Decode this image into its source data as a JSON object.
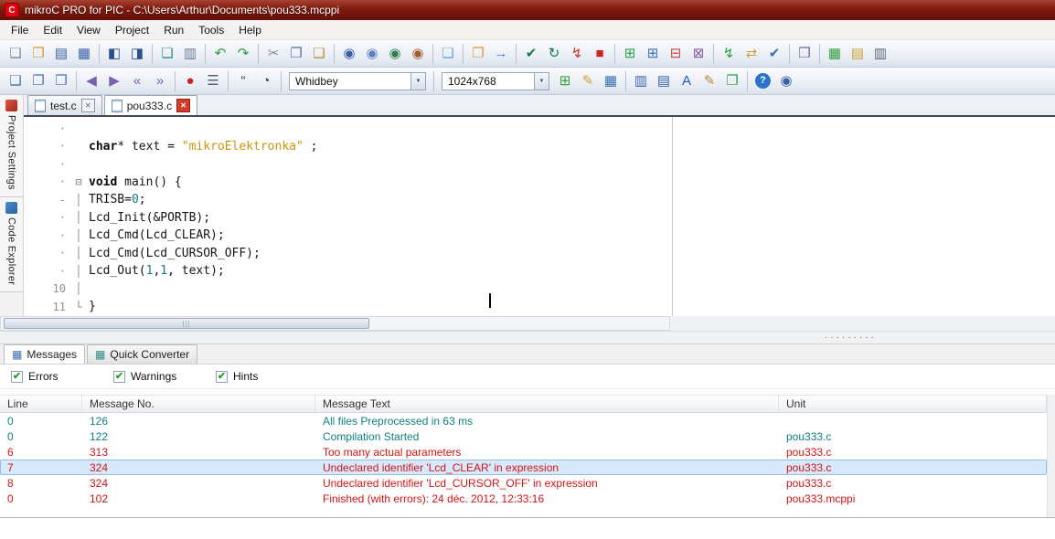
{
  "window": {
    "title": "mikroC PRO for PIC - C:\\Users\\Arthur\\Documents\\pou333.mcppi",
    "logo_letter": "C"
  },
  "menu": {
    "items": [
      "File",
      "Edit",
      "View",
      "Project",
      "Run",
      "Tools",
      "Help"
    ]
  },
  "toolbars": {
    "row1": [
      {
        "t": "i",
        "n": "new-file",
        "g": "❏",
        "c": "#7b8aa0"
      },
      {
        "t": "i",
        "n": "open-file",
        "g": "❒",
        "c": "#d79b2f"
      },
      {
        "t": "i",
        "n": "save-file",
        "g": "▤",
        "c": "#3a5fa8"
      },
      {
        "t": "i",
        "n": "save-all",
        "g": "▦",
        "c": "#3a5fa8"
      },
      {
        "t": "s"
      },
      {
        "t": "i",
        "n": "code-editor",
        "g": "◧",
        "c": "#2e4f8e"
      },
      {
        "t": "i",
        "n": "code-templates",
        "g": "◨",
        "c": "#2e4f8e"
      },
      {
        "t": "s"
      },
      {
        "t": "i",
        "n": "print-preview",
        "g": "❏",
        "c": "#2e8b8b"
      },
      {
        "t": "i",
        "n": "print",
        "g": "▥",
        "c": "#69788c"
      },
      {
        "t": "s"
      },
      {
        "t": "i",
        "n": "undo",
        "g": "↶",
        "c": "#2f9e3f"
      },
      {
        "t": "i",
        "n": "redo",
        "g": "↷",
        "c": "#2f9e3f"
      },
      {
        "t": "s"
      },
      {
        "t": "i",
        "n": "cut",
        "g": "✂",
        "c": "#8a8a8a"
      },
      {
        "t": "i",
        "n": "copy",
        "g": "❐",
        "c": "#4a6fb0"
      },
      {
        "t": "i",
        "n": "paste",
        "g": "❑",
        "c": "#bb8d35"
      },
      {
        "t": "s"
      },
      {
        "t": "i",
        "n": "find",
        "g": "◉",
        "c": "#3a5fa8"
      },
      {
        "t": "i",
        "n": "find-next",
        "g": "◉",
        "c": "#5a7fc0"
      },
      {
        "t": "i",
        "n": "find-in-files",
        "g": "◉",
        "c": "#2e7d4f"
      },
      {
        "t": "i",
        "n": "replace",
        "g": "◉",
        "c": "#a05a2c"
      },
      {
        "t": "s"
      },
      {
        "t": "i",
        "n": "goto-line",
        "g": "❏",
        "c": "#6aa0d8"
      },
      {
        "t": "s"
      },
      {
        "t": "i",
        "n": "copy-rtf",
        "g": "❐",
        "c": "#d79b2f"
      },
      {
        "t": "i",
        "n": "export-code",
        "g": "→",
        "c": "#3a7fd0"
      },
      {
        "t": "s"
      },
      {
        "t": "i",
        "n": "build-project",
        "g": "✔",
        "c": "#117a4a"
      },
      {
        "t": "i",
        "n": "rebuild-all",
        "g": "↻",
        "c": "#117a4a"
      },
      {
        "t": "i",
        "n": "build-and-program",
        "g": "↯",
        "c": "#cc3322"
      },
      {
        "t": "i",
        "n": "stop-build",
        "g": "■",
        "c": "#cc2222"
      },
      {
        "t": "s"
      },
      {
        "t": "i",
        "n": "new-project",
        "g": "⊞",
        "c": "#2f9e3f"
      },
      {
        "t": "i",
        "n": "add-file-to-project",
        "g": "⊞",
        "c": "#3a6fb0"
      },
      {
        "t": "i",
        "n": "remove-file-from-project",
        "g": "⊟",
        "c": "#cc4433"
      },
      {
        "t": "i",
        "n": "close-project",
        "g": "⊠",
        "c": "#8a5a9a"
      },
      {
        "t": "s"
      },
      {
        "t": "i",
        "n": "program-mcu",
        "g": "↯",
        "c": "#2f9e3f"
      },
      {
        "t": "i",
        "n": "read-mcu",
        "g": "⇄",
        "c": "#caa23a"
      },
      {
        "t": "i",
        "n": "verify-mcu",
        "g": "✔",
        "c": "#3a6fb0"
      },
      {
        "t": "s"
      },
      {
        "t": "i",
        "n": "package-manager",
        "g": "❒",
        "c": "#7a5fb0"
      },
      {
        "t": "s"
      },
      {
        "t": "i",
        "n": "library-manager",
        "g": "▦",
        "c": "#2f9e3f"
      },
      {
        "t": "i",
        "n": "options",
        "g": "▤",
        "c": "#caa23a"
      },
      {
        "t": "i",
        "n": "statistics",
        "g": "▥",
        "c": "#556677"
      }
    ],
    "row2": [
      {
        "t": "i",
        "n": "show-procedures-list",
        "g": "❑",
        "c": "#4a6fb0"
      },
      {
        "t": "i",
        "n": "show-code-explorer",
        "g": "❐",
        "c": "#4a6fb0"
      },
      {
        "t": "i",
        "n": "show-project-manager",
        "g": "❒",
        "c": "#4a6fb0"
      },
      {
        "t": "s"
      },
      {
        "t": "i",
        "n": "outdent",
        "g": "◀",
        "c": "#7a5fb0"
      },
      {
        "t": "i",
        "n": "indent",
        "g": "▶",
        "c": "#7a5fb0"
      },
      {
        "t": "i",
        "n": "comment-lines",
        "g": "«",
        "c": "#7a5fb0"
      },
      {
        "t": "i",
        "n": "uncomment-lines",
        "g": "»",
        "c": "#7a5fb0"
      },
      {
        "t": "s"
      },
      {
        "t": "i",
        "n": "record-macro",
        "g": "●",
        "c": "#cc2222"
      },
      {
        "t": "i",
        "n": "macros-list",
        "g": "☰",
        "c": "#556677"
      },
      {
        "t": "s"
      },
      {
        "t": "i",
        "n": "toggle-comment",
        "g": "“",
        "c": "#3a4a5a"
      },
      {
        "t": "i",
        "n": "stopwatch",
        "g": "◔",
        "c": "#3a4a5a"
      },
      {
        "t": "s"
      },
      {
        "t": "c",
        "n": "style-combo",
        "v": "Whidbey",
        "w": 150
      },
      {
        "t": "s"
      },
      {
        "t": "c",
        "n": "resolution-combo",
        "v": "1024x768",
        "w": 118
      },
      {
        "t": "i",
        "n": "add-display",
        "g": "⊞",
        "c": "#2f9e3f"
      },
      {
        "t": "i",
        "n": "edit-display",
        "g": "✎",
        "c": "#caa23a"
      },
      {
        "t": "i",
        "n": "display-grid",
        "g": "▦",
        "c": "#3a6fb0"
      },
      {
        "t": "s"
      },
      {
        "t": "i",
        "n": "show-breakpoints",
        "g": "▥",
        "c": "#3a5fa8"
      },
      {
        "t": "i",
        "n": "show-watch-window",
        "g": "▤",
        "c": "#3a5fa8"
      },
      {
        "t": "i",
        "n": "font-settings",
        "g": "A",
        "c": "#2255cc"
      },
      {
        "t": "i",
        "n": "edit-settings",
        "g": "✎",
        "c": "#b98a33"
      },
      {
        "t": "i",
        "n": "window-layout",
        "g": "❐",
        "c": "#2f9e3f"
      },
      {
        "t": "s"
      },
      {
        "t": "i",
        "n": "help",
        "g": "?",
        "c": "#ffffff",
        "bg": "#2a72cc",
        "round": true
      },
      {
        "t": "i",
        "n": "search-help",
        "g": "◉",
        "c": "#3a5fa8"
      }
    ]
  },
  "doc_tabs": [
    {
      "label": "test.c",
      "active": false
    },
    {
      "label": "pou333.c",
      "active": true
    }
  ],
  "sidebar": {
    "tabs": [
      {
        "label": "Project Settings",
        "icon": "project-settings-icon",
        "color1": "#e05545",
        "color2": "#a02818"
      },
      {
        "label": "Code Explorer",
        "icon": "code-explorer-icon",
        "color1": "#4a8fd0",
        "color2": "#2a5fa0"
      }
    ]
  },
  "editor": {
    "lines": [
      {
        "g": "·",
        "f": "",
        "tk": []
      },
      {
        "g": "·",
        "f": "",
        "tk": [
          {
            "c": "k",
            "t": "char"
          },
          {
            "c": "p",
            "t": "* text = "
          },
          {
            "c": "s",
            "t": "\"mikroElektronka\""
          },
          {
            "c": "p",
            "t": " ;"
          }
        ]
      },
      {
        "g": "·",
        "f": "",
        "tk": []
      },
      {
        "g": "·",
        "f": "open",
        "tk": [
          {
            "c": "k",
            "t": "void"
          },
          {
            "c": "p",
            "t": " main() {"
          }
        ]
      },
      {
        "g": "-",
        "f": "line",
        "tk": [
          {
            "c": "p",
            "t": "TRISB="
          },
          {
            "c": "n",
            "t": "0"
          },
          {
            "c": "p",
            "t": ";"
          }
        ]
      },
      {
        "g": "·",
        "f": "line",
        "tk": [
          {
            "c": "p",
            "t": "Lcd_Init(&PORTB);"
          }
        ]
      },
      {
        "g": "·",
        "f": "line",
        "tk": [
          {
            "c": "p",
            "t": "Lcd_Cmd(Lcd_CLEAR);"
          }
        ]
      },
      {
        "g": "·",
        "f": "line",
        "tk": [
          {
            "c": "p",
            "t": "Lcd_Cmd(Lcd_CURSOR_OFF);"
          }
        ]
      },
      {
        "g": "·",
        "f": "line",
        "tk": [
          {
            "c": "p",
            "t": "Lcd_Out("
          },
          {
            "c": "n",
            "t": "1"
          },
          {
            "c": "p",
            "t": ","
          },
          {
            "c": "n",
            "t": "1"
          },
          {
            "c": "p",
            "t": ", text);"
          }
        ]
      },
      {
        "g": "10",
        "f": "line",
        "tk": []
      },
      {
        "g": "11",
        "f": "end",
        "tk": [
          {
            "c": "p",
            "t": "}"
          }
        ]
      }
    ]
  },
  "bottom": {
    "tabs": [
      {
        "label": "Messages",
        "icon": "messages-icon",
        "glyph": "▦",
        "color": "#3a6fb0",
        "active": true
      },
      {
        "label": "Quick Converter",
        "icon": "quick-converter-icon",
        "glyph": "▦",
        "color": "#2e8b8b",
        "active": false
      }
    ],
    "filters": [
      {
        "label": "Errors",
        "checked": true
      },
      {
        "label": "Warnings",
        "checked": true
      },
      {
        "label": "Hints",
        "checked": true
      }
    ],
    "table": {
      "columns": [
        "Line",
        "Message No.",
        "Message Text",
        "Unit"
      ],
      "rows": [
        {
          "line": "0",
          "no": "126",
          "text": "All files Preprocessed in 63 ms",
          "unit": "",
          "kind": "info",
          "selected": false
        },
        {
          "line": "0",
          "no": "122",
          "text": "Compilation Started",
          "unit": "pou333.c",
          "kind": "info",
          "selected": false
        },
        {
          "line": "6",
          "no": "313",
          "text": "Too many actual parameters",
          "unit": "pou333.c",
          "kind": "error",
          "selected": false
        },
        {
          "line": "7",
          "no": "324",
          "text": "Undeclared identifier 'Lcd_CLEAR' in expression",
          "unit": "pou333.c",
          "kind": "error",
          "selected": true
        },
        {
          "line": "8",
          "no": "324",
          "text": "Undeclared identifier 'Lcd_CURSOR_OFF' in expression",
          "unit": "pou333.c",
          "kind": "error",
          "selected": false
        },
        {
          "line": "0",
          "no": "102",
          "text": "Finished (with errors): 24 déc. 2012, 12:33:16",
          "unit": "pou333.mcppi",
          "kind": "error",
          "selected": false
        }
      ]
    }
  }
}
